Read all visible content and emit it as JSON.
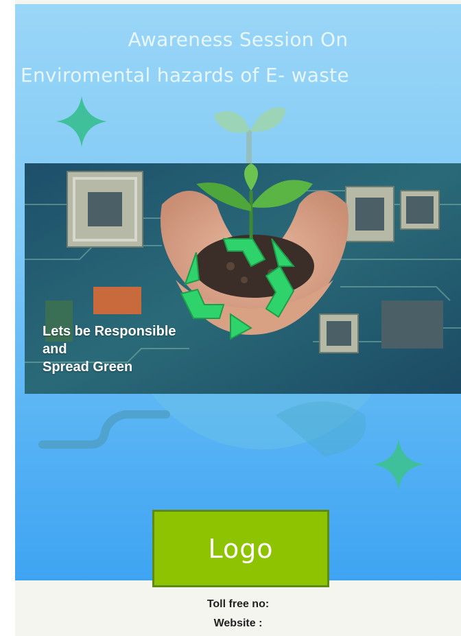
{
  "poster": {
    "title_line1": "Awareness Session On",
    "title_line2": "Enviromental hazards of E- waste",
    "tagline": [
      "Lets be Responsible",
      "and",
      "Spread Green"
    ],
    "logo_label": "Logo",
    "toll_free_label": "Toll free no:",
    "website_label": "Website :"
  },
  "colors": {
    "sky_top": "#9ad6f7",
    "sky_bottom": "#3ea4f2",
    "accent_green": "#8dc300",
    "sparkle": "#3fbf9a",
    "recycle": "#2fd36b"
  },
  "icons": [
    "sparkle-icon",
    "recycle-icon",
    "plant-icon"
  ]
}
